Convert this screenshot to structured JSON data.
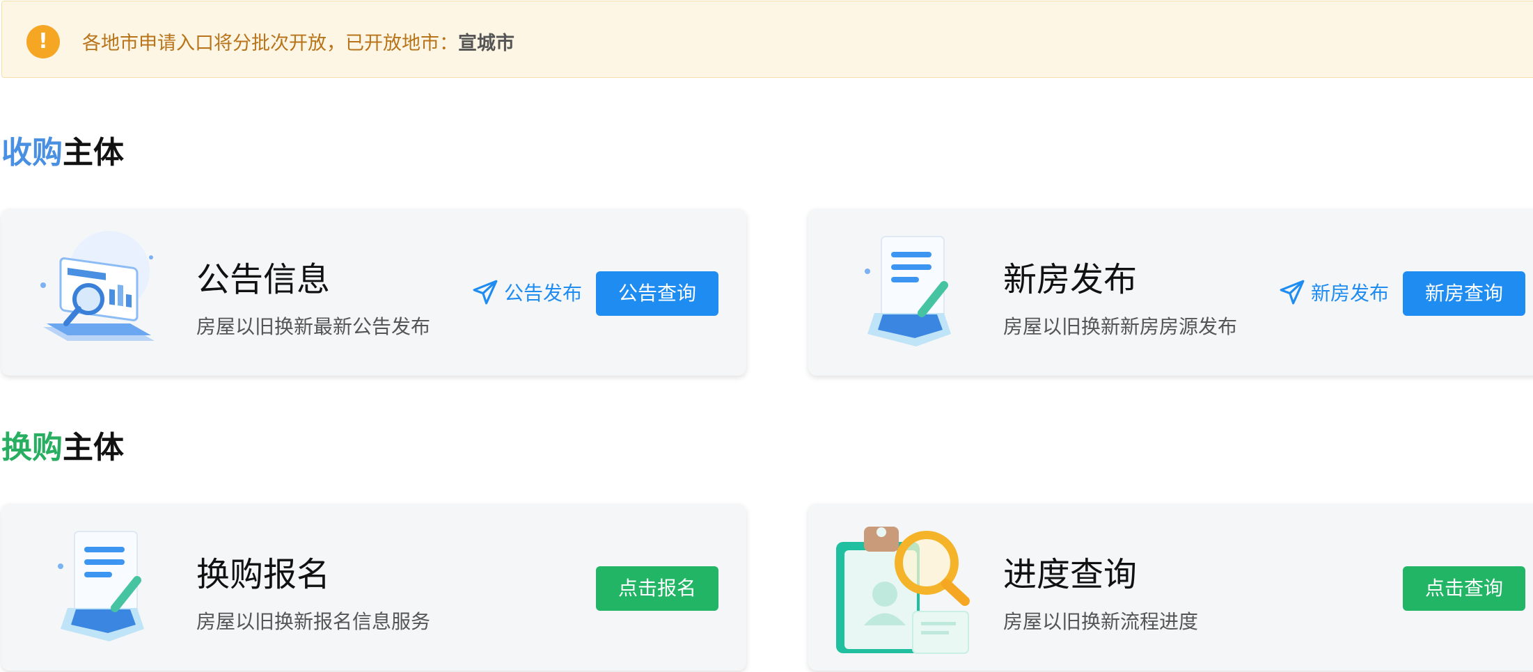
{
  "notice": {
    "text": "各地市申请入口将分批次开放，已开放地市：",
    "city": "宣城市",
    "icon": "warning-exclamation-icon"
  },
  "sections": [
    {
      "title_highlight": "收购",
      "title_rest": "主体",
      "highlight_color": "#4a90e2",
      "cards": [
        {
          "title": "公告信息",
          "desc": "房屋以旧换新最新公告发布",
          "link": "公告发布",
          "button": "公告查询",
          "button_color": "#1e8cf0"
        },
        {
          "title": "新房发布",
          "desc": "房屋以旧换新新房房源发布",
          "link": "新房发布",
          "button": "新房查询",
          "button_color": "#1e8cf0"
        }
      ]
    },
    {
      "title_highlight": "换购",
      "title_rest": "主体",
      "highlight_color": "#27ae60",
      "cards": [
        {
          "title": "换购报名",
          "desc": "房屋以旧换新报名信息服务",
          "button": "点击报名",
          "button_color": "#22b566"
        },
        {
          "title": "进度查询",
          "desc": "房屋以旧换新流程进度",
          "button": "点击查询",
          "button_color": "#22b566"
        }
      ]
    }
  ]
}
